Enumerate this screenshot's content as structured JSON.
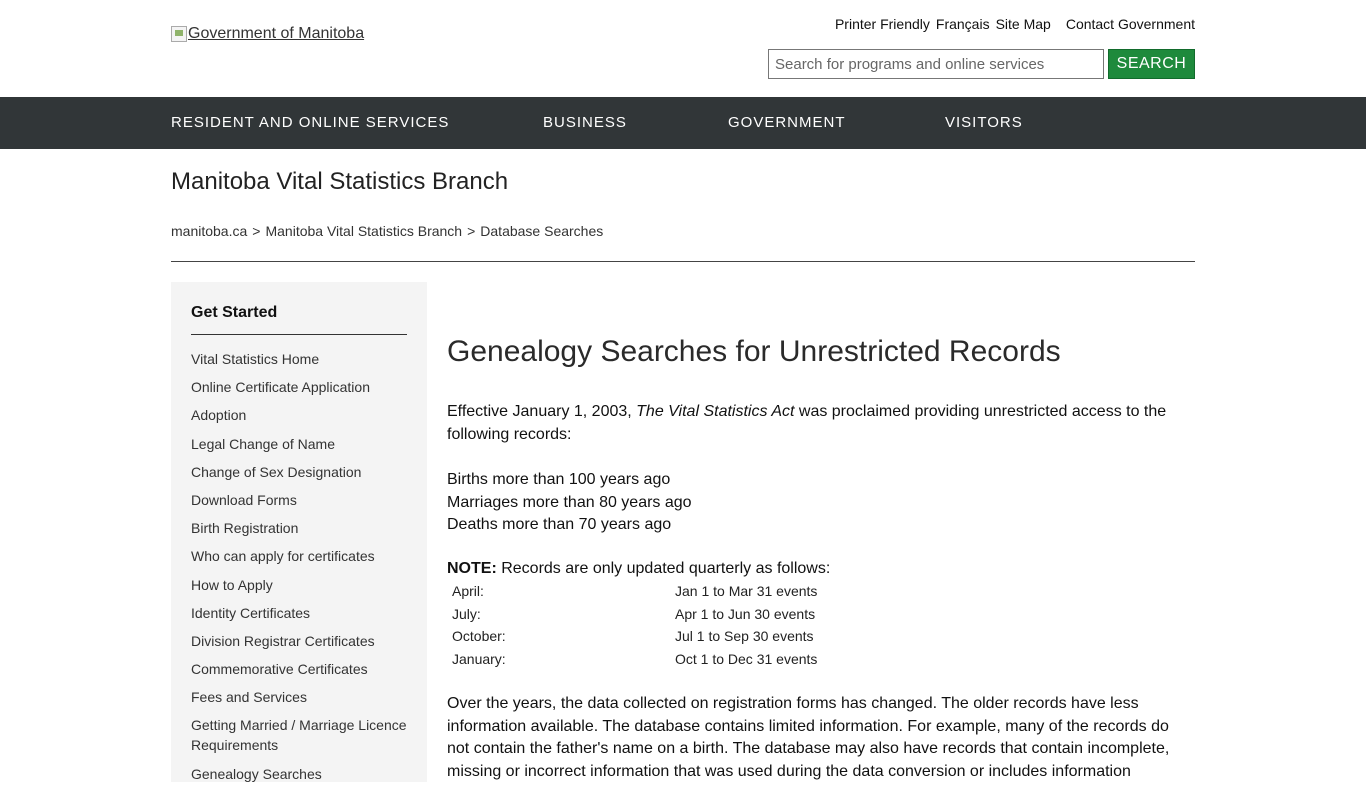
{
  "header": {
    "logo_alt": "Government of Manitoba",
    "utility_links": [
      "Printer Friendly",
      "Français",
      "Site Map",
      "Contact Government"
    ],
    "search_placeholder": "Search for programs and online services",
    "search_button": "SEARCH",
    "search_button_color": "#1e8a3c"
  },
  "nav": {
    "items": [
      "RESIDENT AND ONLINE SERVICES",
      "BUSINESS",
      "GOVERNMENT",
      "VISITORS"
    ],
    "background": "#313638"
  },
  "branch_title": "Manitoba Vital Statistics Branch",
  "breadcrumb": [
    "manitoba.ca",
    "Manitoba Vital Statistics Branch",
    "Database Searches"
  ],
  "sidebar": {
    "heading": "Get Started",
    "items": [
      "Vital Statistics Home",
      "Online Certificate Application",
      "Adoption",
      "Legal Change of Name",
      "Change of Sex Designation",
      "Download Forms",
      "Birth Registration",
      "Who can apply for certificates",
      "How to Apply",
      "Identity Certificates",
      "Division Registrar Certificates",
      "Commemorative Certificates",
      "Fees and Services",
      "Getting Married / Marriage Licence Requirements",
      "Genealogy Searches"
    ]
  },
  "main": {
    "title": "Genealogy Searches for Unrestricted Records",
    "intro_pre": "Effective January 1, 2003, ",
    "intro_act": "The Vital Statistics Act",
    "intro_post": " was proclaimed providing unrestricted access to the following records:",
    "records": [
      "Births more than 100 years ago",
      "Marriages more than 80 years ago",
      "Deaths more than 70 years ago"
    ],
    "note_label": "NOTE:",
    "note_text": " Records are only updated quarterly as follows:",
    "schedule": [
      {
        "month": "April:",
        "events": "Jan 1 to Mar 31 events"
      },
      {
        "month": "July:",
        "events": "Apr 1 to Jun 30 events"
      },
      {
        "month": "October:",
        "events": "Jul 1 to Sep 30 events"
      },
      {
        "month": "January:",
        "events": "Oct 1 to Dec 31 events"
      }
    ],
    "closing": "Over the years, the data collected on registration forms has changed. The older records have less information available. The database contains limited information. For example, many of the records do not contain the father's name on a birth. The database may also have records that contain incomplete, missing or incorrect information that was used during the data conversion or includes information"
  }
}
